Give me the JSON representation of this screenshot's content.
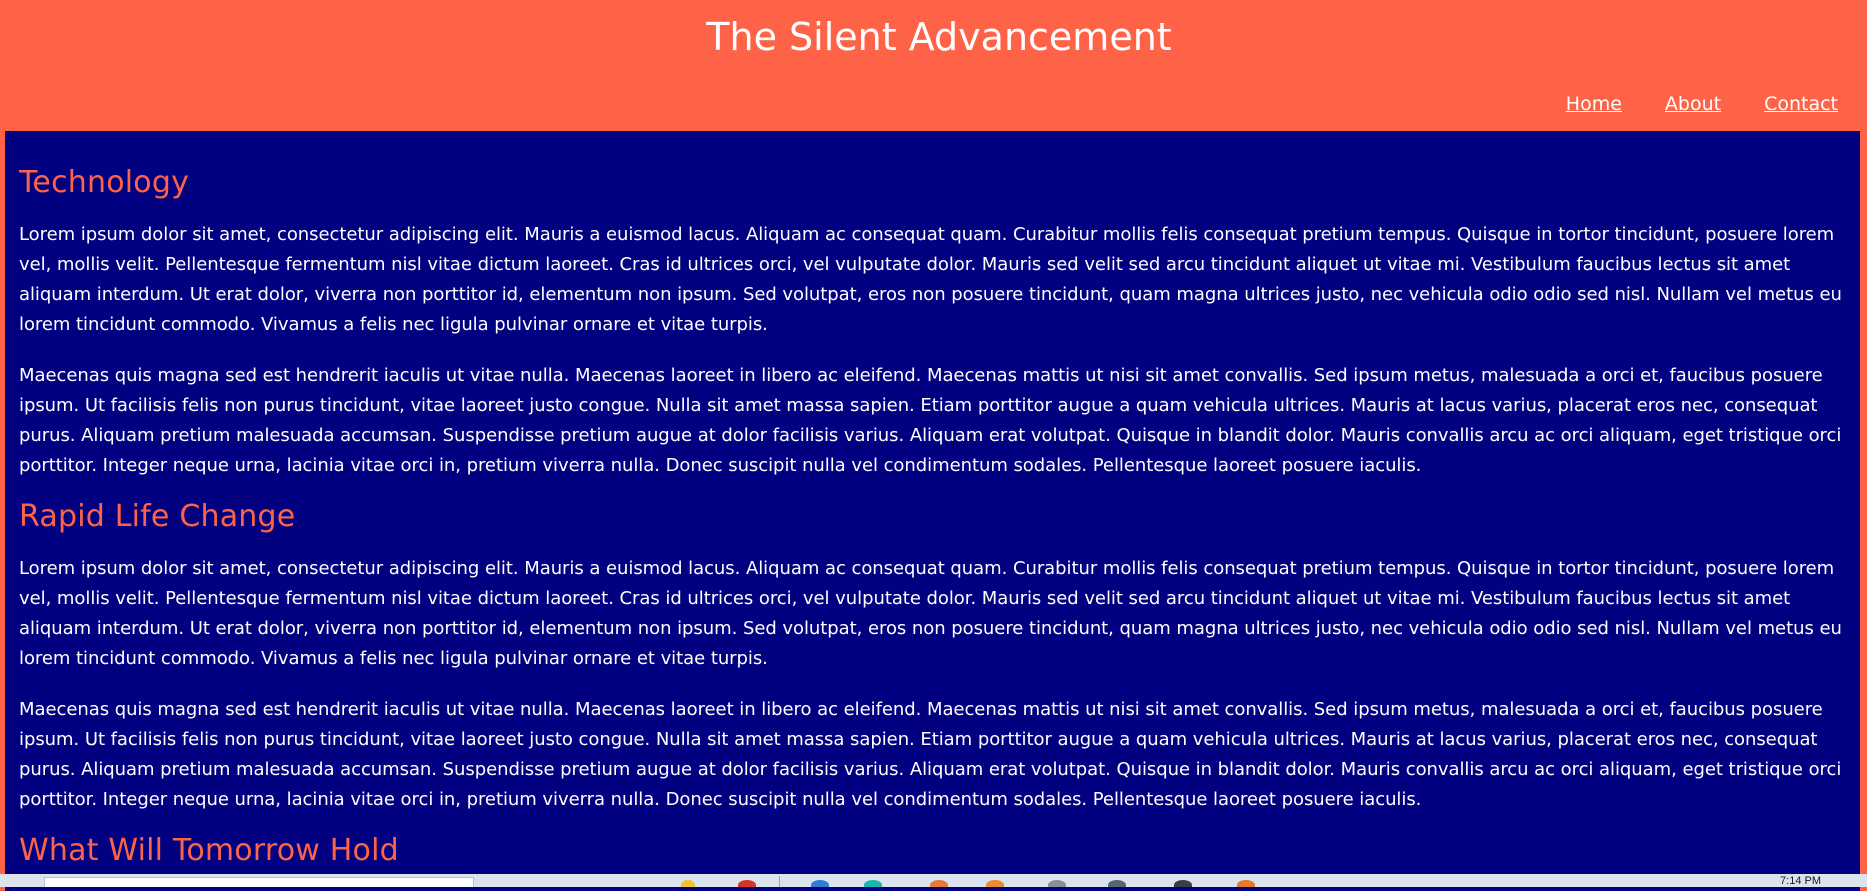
{
  "header": {
    "title": "The Silent Advancement",
    "nav": [
      "Home",
      "About",
      "Contact"
    ]
  },
  "sections": [
    {
      "heading": "Technology",
      "paragraphs": [
        "Lorem ipsum dolor sit amet, consectetur adipiscing elit. Mauris a euismod lacus. Aliquam ac consequat quam. Curabitur mollis felis consequat pretium tempus. Quisque in tortor tincidunt, posuere lorem vel, mollis velit. Pellentesque fermentum nisl vitae dictum laoreet. Cras id ultrices orci, vel vulputate dolor. Mauris sed velit sed arcu tincidunt aliquet ut vitae mi. Vestibulum faucibus lectus sit amet aliquam interdum. Ut erat dolor, viverra non porttitor id, elementum non ipsum. Sed volutpat, eros non posuere tincidunt, quam magna ultrices justo, nec vehicula odio odio sed nisl. Nullam vel metus eu lorem tincidunt commodo. Vivamus a felis nec ligula pulvinar ornare et vitae turpis.",
        "Maecenas quis magna sed est hendrerit iaculis ut vitae nulla. Maecenas laoreet in libero ac eleifend. Maecenas mattis ut nisi sit amet convallis. Sed ipsum metus, malesuada a orci et, faucibus posuere ipsum. Ut facilisis felis non purus tincidunt, vitae laoreet justo congue. Nulla sit amet massa sapien. Etiam porttitor augue a quam vehicula ultrices. Mauris at lacus varius, placerat eros nec, consequat purus. Aliquam pretium malesuada accumsan. Suspendisse pretium augue at dolor facilisis varius. Aliquam erat volutpat. Quisque in blandit dolor. Mauris convallis arcu ac orci aliquam, eget tristique orci porttitor. Integer neque urna, lacinia vitae orci in, pretium viverra nulla. Donec suscipit nulla vel condimentum sodales. Pellentesque laoreet posuere iaculis."
      ]
    },
    {
      "heading": "Rapid Life Change",
      "paragraphs": [
        "Lorem ipsum dolor sit amet, consectetur adipiscing elit. Mauris a euismod lacus. Aliquam ac consequat quam. Curabitur mollis felis consequat pretium tempus. Quisque in tortor tincidunt, posuere lorem vel, mollis velit. Pellentesque fermentum nisl vitae dictum laoreet. Cras id ultrices orci, vel vulputate dolor. Mauris sed velit sed arcu tincidunt aliquet ut vitae mi. Vestibulum faucibus lectus sit amet aliquam interdum. Ut erat dolor, viverra non porttitor id, elementum non ipsum. Sed volutpat, eros non posuere tincidunt, quam magna ultrices justo, nec vehicula odio odio sed nisl. Nullam vel metus eu lorem tincidunt commodo. Vivamus a felis nec ligula pulvinar ornare et vitae turpis.",
        "Maecenas quis magna sed est hendrerit iaculis ut vitae nulla. Maecenas laoreet in libero ac eleifend. Maecenas mattis ut nisi sit amet convallis. Sed ipsum metus, malesuada a orci et, faucibus posuere ipsum. Ut facilisis felis non purus tincidunt, vitae laoreet justo congue. Nulla sit amet massa sapien. Etiam porttitor augue a quam vehicula ultrices. Mauris at lacus varius, placerat eros nec, consequat purus. Aliquam pretium malesuada accumsan. Suspendisse pretium augue at dolor facilisis varius. Aliquam erat volutpat. Quisque in blandit dolor. Mauris convallis arcu ac orci aliquam, eget tristique orci porttitor. Integer neque urna, lacinia vitae orci in, pretium viverra nulla. Donec suscipit nulla vel condimentum sodales. Pellentesque laoreet posuere iaculis."
      ]
    },
    {
      "heading": "What Will Tomorrow Hold",
      "paragraphs": []
    }
  ],
  "taskbar": {
    "clock": "7:14 PM"
  },
  "colors": {
    "header_bg": "#ff6347",
    "content_bg": "#000080",
    "heading": "#ff6347",
    "text": "#ffffff"
  }
}
